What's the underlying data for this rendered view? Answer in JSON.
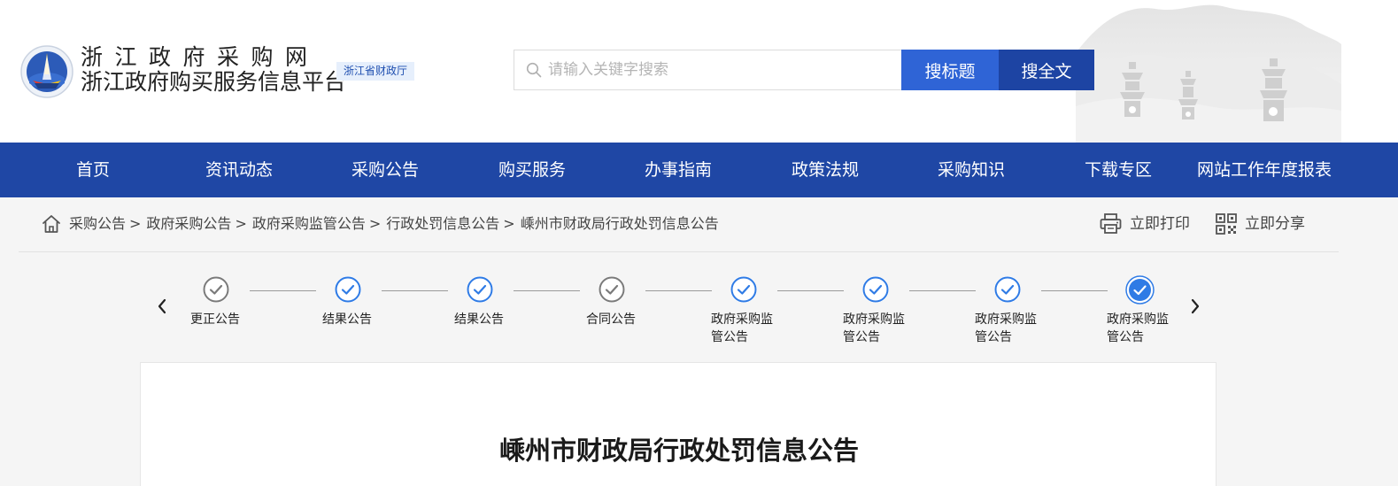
{
  "header": {
    "site_name_line1": "浙江政府采购网",
    "site_name_line2": "浙江政府购买服务信息平台",
    "dept_badge": "浙江省财政厅",
    "logo_icon": "zhejiang-procurement-logo",
    "search": {
      "placeholder": "请输入关键字搜索",
      "value": "",
      "icon": "search-icon",
      "btn_title": "搜标题",
      "btn_fulltext": "搜全文"
    },
    "decoration": "ink-mountain-pagodas"
  },
  "nav": {
    "items": [
      "首页",
      "资讯动态",
      "采购公告",
      "购买服务",
      "办事指南",
      "政策法规",
      "采购知识",
      "下载专区",
      "网站工作年度报表"
    ]
  },
  "breadcrumb": {
    "home_icon": "home-icon",
    "items": [
      "采购公告",
      "政府采购公告",
      "政府采购监管公告",
      "行政处罚信息公告"
    ],
    "separator": ">",
    "current": "嵊州市财政局行政处罚信息公告",
    "print_label": "立即打印",
    "share_label": "立即分享",
    "print_icon": "printer-icon",
    "share_icon": "qrcode-icon"
  },
  "timeline": {
    "prev_icon": "chevron-left-icon",
    "next_icon": "chevron-right-icon",
    "steps": [
      {
        "label": "更正公告",
        "state": "done-gray"
      },
      {
        "label": "结果公告",
        "state": "done-blue"
      },
      {
        "label": "结果公告",
        "state": "done-blue"
      },
      {
        "label": "合同公告",
        "state": "done-gray"
      },
      {
        "label": "政府采购监管公告",
        "state": "done-blue"
      },
      {
        "label": "政府采购监管公告",
        "state": "done-blue"
      },
      {
        "label": "政府采购监管公告",
        "state": "done-blue"
      },
      {
        "label": "政府采购监管公告",
        "state": "current"
      }
    ]
  },
  "article": {
    "title": "嵊州市财政局行政处罚信息公告"
  },
  "colors": {
    "nav_bg": "#1f47a5",
    "btn_title_bg": "#2f64d6",
    "btn_full_bg": "#1d44a3",
    "step_blue": "#2f7be5",
    "step_gray": "#7a7a7a",
    "page_bg": "#f5f5f5"
  }
}
